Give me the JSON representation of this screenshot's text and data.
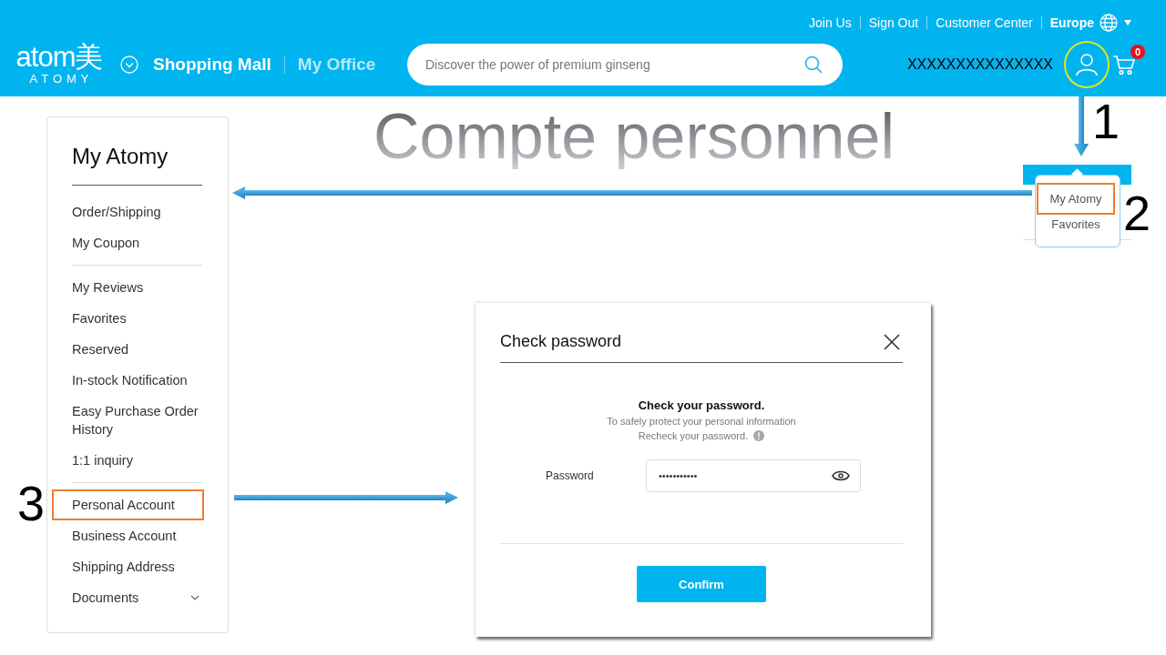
{
  "header": {
    "top_links": [
      {
        "label": "Join Us"
      },
      {
        "label": "Sign Out"
      },
      {
        "label": "Customer Center"
      }
    ],
    "region": "Europe",
    "logo": {
      "wordmark": "atom美",
      "tagline": "ATOMY"
    },
    "nav": [
      {
        "label": "Shopping Mall",
        "selected": true
      },
      {
        "label": "My Office",
        "selected": false
      }
    ],
    "search": {
      "placeholder": "Discover the power of premium ginseng"
    },
    "username": "XXXXXXXXXXXXXXX",
    "account_button": {
      "highlighted": true
    },
    "cart_count": "0"
  },
  "page_title": "Compte personnel",
  "sidebar": {
    "title": "My Atomy",
    "groups": [
      {
        "items": [
          {
            "label": "Order/Shipping",
            "kind": "link",
            "highlighted": false
          },
          {
            "label": "My Coupon",
            "kind": "link",
            "highlighted": false
          }
        ]
      },
      {
        "items": [
          {
            "label": "My Reviews",
            "kind": "link",
            "highlighted": false
          },
          {
            "label": "Favorites",
            "kind": "link",
            "highlighted": false
          },
          {
            "label": "Reserved",
            "kind": "link",
            "highlighted": false
          },
          {
            "label": "In-stock Notification",
            "kind": "link",
            "highlighted": false
          },
          {
            "label": "Easy Purchase Order History",
            "kind": "link",
            "highlighted": false
          },
          {
            "label": "1:1 inquiry",
            "kind": "link",
            "highlighted": false
          }
        ]
      },
      {
        "items": [
          {
            "label": "Personal Account",
            "kind": "link",
            "highlighted": true
          },
          {
            "label": "Business Account",
            "kind": "link",
            "highlighted": false
          },
          {
            "label": "Shipping Address",
            "kind": "link",
            "highlighted": false
          },
          {
            "label": "Documents",
            "kind": "expandable",
            "highlighted": false
          }
        ]
      }
    ]
  },
  "user_menu": {
    "items": [
      {
        "label": "My Atomy",
        "highlighted": true
      },
      {
        "label": "Favorites",
        "highlighted": false
      }
    ]
  },
  "dialog": {
    "title": "Check password",
    "heading": "Check your password.",
    "lines": [
      {
        "text": "To safely protect your personal information",
        "info_icon": false
      },
      {
        "text": "Recheck your password.",
        "info_icon": true
      }
    ],
    "field": {
      "label": "Password",
      "value": "•••••••••••"
    },
    "button": "Confirm"
  },
  "annotations": {
    "steps": [
      {
        "label": "1"
      },
      {
        "label": "2"
      },
      {
        "label": "3"
      }
    ]
  }
}
